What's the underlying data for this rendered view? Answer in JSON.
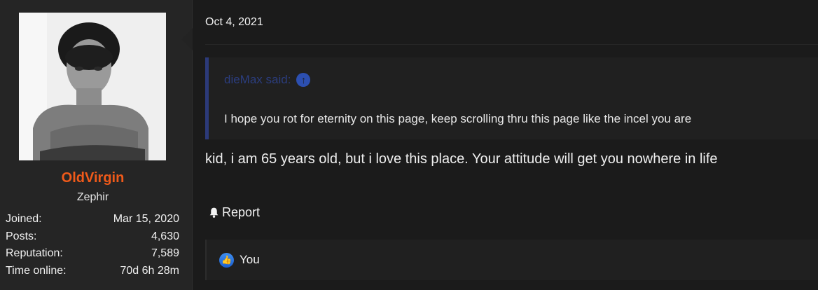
{
  "user": {
    "username": "OldVirgin",
    "title": "Zephir",
    "stats": [
      {
        "label": "Joined:",
        "value": "Mar 15, 2020"
      },
      {
        "label": "Posts:",
        "value": "4,630"
      },
      {
        "label": "Reputation:",
        "value": "7,589"
      },
      {
        "label": "Time online:",
        "value": "70d 6h 28m"
      }
    ]
  },
  "post": {
    "date": "Oct 4, 2021",
    "quote": {
      "author": "dieMax said:",
      "text": "I hope you rot for eternity on this page, keep scrolling thru this page like the incel you are"
    },
    "message": "kid, i am 65 years old, but i love this place. Your attitude will get you nowhere in life",
    "report_label": "Report",
    "reactions": {
      "text": "You"
    }
  },
  "colors": {
    "username": "#f05a1a",
    "quote_author": "#2b3d7e",
    "quote_border": "#2c3a7a",
    "like_blue": "#1a5fd0"
  },
  "icons": [
    "bell-icon",
    "arrow-up-circle-icon",
    "thumbs-up-icon"
  ]
}
